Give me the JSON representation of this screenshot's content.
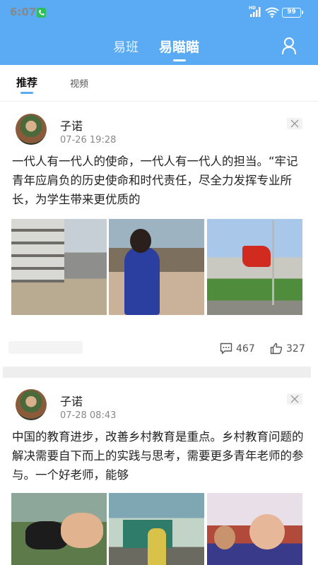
{
  "status_bar": {
    "time": "6:07",
    "network": "HD",
    "battery": "99"
  },
  "header": {
    "tab_ban": "易班",
    "tab_miaomiao": "易瞄瞄"
  },
  "subtabs": {
    "recommend": "推荐",
    "video": "视频"
  },
  "colors": {
    "header_bg": "#5aabf3",
    "accent": "#5aabf3"
  },
  "posts": [
    {
      "author": "子诺",
      "time": "07-26 19:28",
      "text": "一代人有一代人的使命，一代人有一代人的担当。“牢记青年应肩负的历史使命和时代责任，尽全力发挥专业所长，为学生带来更优质的",
      "images": [
        "school-building-photo",
        "children-playing-photo",
        "flag-raising-photo"
      ],
      "comments": "467",
      "likes": "327"
    },
    {
      "author": "子诺",
      "time": "07-28 08:43",
      "text": "中国的教育进步，改善乡村教育是重点。乡村教育问题的解决需要自下而上的实践与思考，需要更多青年老师的参与。一个好老师，能够",
      "images": [
        "child-with-dog-photo",
        "classroom-teacher-photo",
        "group-kids-photo"
      ]
    }
  ]
}
